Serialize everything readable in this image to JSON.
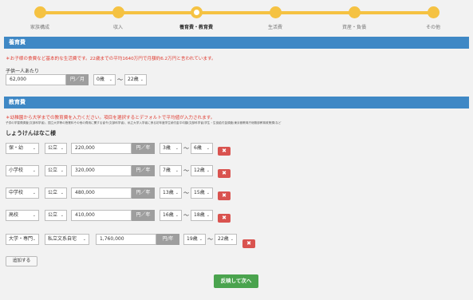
{
  "steps": [
    {
      "label": "家族構成",
      "current": false
    },
    {
      "label": "収入",
      "current": false
    },
    {
      "label": "養育費・教育費",
      "current": true
    },
    {
      "label": "生活費",
      "current": false
    },
    {
      "label": "資産・負債",
      "current": false
    },
    {
      "label": "その他",
      "current": false
    }
  ],
  "childcare": {
    "title": "養育費",
    "note": "＊お子様の食費など基本的な生活費です。22歳までの平均1640万円で月額約6.2万円と言われています。",
    "per_child_label": "子供一人あたり",
    "amount": "62,000",
    "unit": "円／月",
    "from_age": "0歳",
    "to_age": "22歳",
    "tilde": "〜"
  },
  "education": {
    "title": "教育費",
    "note": "＊幼稚園から大学までの教育費を入力ください。項目を選択するとデフォルトで平均値が入力されます。",
    "sources": "子供の学習費調査(文部科学省)、国立大学等の授業料その他の費用に関する省令(文部科学省)、私立大学入学者に係る初年度学生納付金平均額(文部科学省)学生・生徒給付金調査(東京都教育庁総務部教育政策課)など",
    "child_name": "しょうけんはなこ様",
    "rows": [
      {
        "stage": "保・幼",
        "type": "公立",
        "amount": "220,000",
        "unit": "円／年",
        "from": "3歳",
        "to": "6歳"
      },
      {
        "stage": "小学校",
        "type": "公立",
        "amount": "320,000",
        "unit": "円／年",
        "from": "7歳",
        "to": "12歳"
      },
      {
        "stage": "中学校",
        "type": "公立",
        "amount": "480,000",
        "unit": "円／年",
        "from": "13歳",
        "to": "15歳"
      },
      {
        "stage": "高校",
        "type": "公立",
        "amount": "410,000",
        "unit": "円／年",
        "from": "16歳",
        "to": "18歳"
      },
      {
        "stage": "大学・専門",
        "type": "私立文系自宅",
        "amount": "1,760,000",
        "unit": "円/年",
        "from": "19歳",
        "to": "22歳"
      }
    ],
    "delete_glyph": "✖",
    "add_label": "追加する"
  },
  "next_label": "反映して次へ"
}
